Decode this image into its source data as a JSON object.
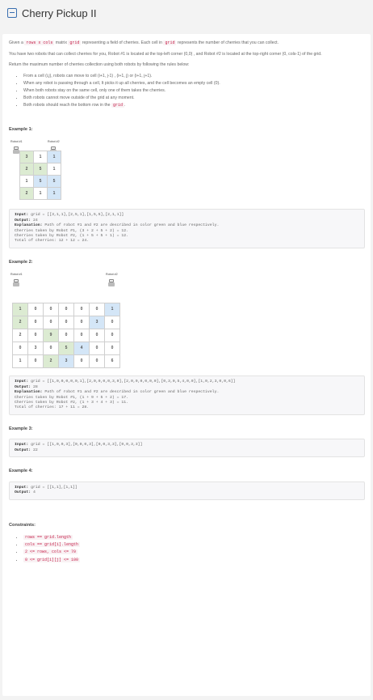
{
  "header": {
    "title": "Cherry Pickup II"
  },
  "intro": {
    "p1_a": "Given a ",
    "p1_code1": "rows x cols",
    "p1_b": " matrix ",
    "p1_code2": "grid",
    "p1_c": " representing a field of cherries. Each cell in ",
    "p1_code3": "grid",
    "p1_d": " represents the number of cherries that you can collect.",
    "p2": "You have two robots that can collect cherries for you, Robot #1 is located at the top-left corner (0,0) , and Robot #2 is located at the top-right corner (0, cols-1) of the grid.",
    "p3": "Return the maximum number of cherries collection using both robots  by following the rules below:"
  },
  "rules": [
    "From a cell (i,j), robots can move to cell (i+1, j-1) , (i+1, j) or (i+1, j+1).",
    "When any robot is passing through a cell, It picks it up all cherries, and the cell becomes an empty cell (0).",
    "When both robots stay on the same cell, only one of them takes the cherries.",
    "Both robots cannot move outside of the grid at any moment.",
    "Both robots should reach the bottom row in the "
  ],
  "rules_last_code": "grid",
  "ex1": {
    "label": "Example 1:",
    "robot1": "Robot #1",
    "robot2": "Robot #2",
    "grid": [
      [
        "3",
        "1",
        "1"
      ],
      [
        "2",
        "5",
        "1"
      ],
      [
        "1",
        "5",
        "5"
      ],
      [
        "2",
        "1",
        "1"
      ]
    ],
    "input_label": "Input:",
    "input": " grid = [[3,1,1],[2,5,1],[1,5,5],[2,1,1]]",
    "output_label": "Output:",
    "output": " 24",
    "expl_label": "Explanation:",
    "expl": " Path of robot #1 and #2 are described in color green and blue respectively.",
    "l1": "Cherries taken by Robot #1, (3 + 2 + 5 + 2) = 12.",
    "l2": "Cherries taken by Robot #2, (1 + 5 + 5 + 1) = 12.",
    "l3": "Total of cherries: 12 + 12 = 24."
  },
  "ex2": {
    "label": "Example 2:",
    "robot1": "Robot #1",
    "robot2": "Robot #2",
    "grid": [
      [
        "1",
        "0",
        "0",
        "0",
        "0",
        "0",
        "1"
      ],
      [
        "2",
        "0",
        "0",
        "0",
        "0",
        "3",
        "0"
      ],
      [
        "2",
        "0",
        "9",
        "0",
        "0",
        "0",
        "0"
      ],
      [
        "0",
        "3",
        "0",
        "5",
        "4",
        "0",
        "0"
      ],
      [
        "1",
        "0",
        "2",
        "3",
        "0",
        "0",
        "6"
      ]
    ],
    "input_label": "Input:",
    "input": " grid = [[1,0,0,0,0,0,1],[2,0,0,0,0,3,0],[2,0,9,0,0,0,0],[0,3,0,5,4,0,0],[1,0,2,3,0,0,6]]",
    "output_label": "Output:",
    "output": " 28",
    "expl_label": "Explanation:",
    "expl": " Path of robot #1 and #2 are described in color green and blue respectively.",
    "l1": "Cherries taken by Robot #1, (1 + 9 + 5 + 2) = 17.",
    "l2": "Cherries taken by Robot #2, (1 + 3 + 4 + 3) = 11.",
    "l3": "Total of cherries: 17 + 11 = 28."
  },
  "ex3": {
    "label": "Example 3:",
    "input_label": "Input:",
    "input": " grid = [[1,0,0,3],[0,0,0,3],[0,0,3,3],[0,0,3,3]]",
    "output_label": "Output:",
    "output": " 22"
  },
  "ex4": {
    "label": "Example 4:",
    "input_label": "Input:",
    "input": " grid = [[1,1],[1,1]]",
    "output_label": "Output:",
    "output": " 4"
  },
  "constraints": {
    "label": "Constraints:",
    "items": [
      "rows == grid.length",
      "cols == grid[i].length",
      "2 <= rows, cols <= 70",
      "0 <= grid[i][j] <= 100"
    ]
  }
}
